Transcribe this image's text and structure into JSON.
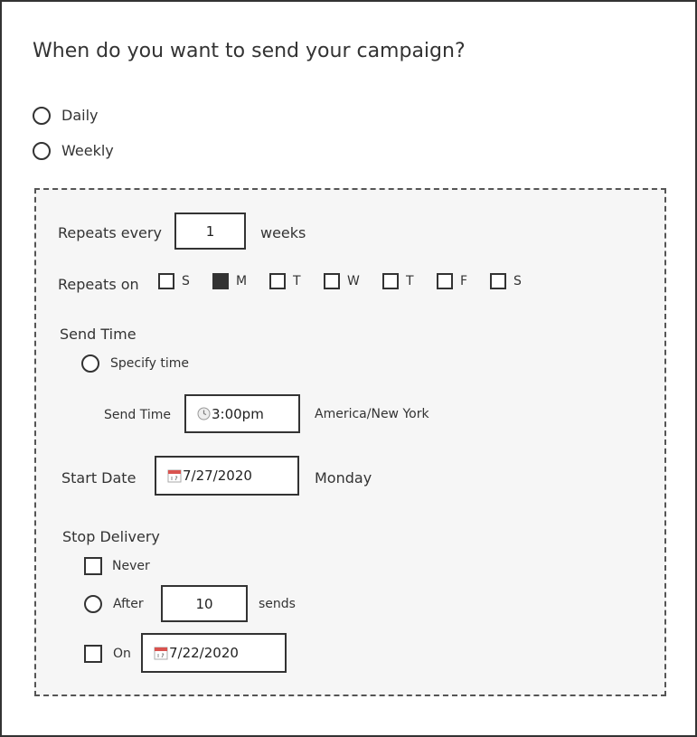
{
  "page": {
    "title": "When do you want to send your campaign?"
  },
  "frequency": {
    "options": [
      {
        "label": "Daily",
        "selected": false
      },
      {
        "label": "Weekly",
        "selected": false
      }
    ]
  },
  "settings": {
    "repeats_every": {
      "label": "Repeats every",
      "value": "1",
      "unit": "weeks"
    },
    "repeats_on": {
      "label": "Repeats on",
      "days": [
        {
          "label": "S",
          "checked": false
        },
        {
          "label": "M",
          "checked": true
        },
        {
          "label": "T",
          "checked": false
        },
        {
          "label": "W",
          "checked": false
        },
        {
          "label": "T",
          "checked": false
        },
        {
          "label": "F",
          "checked": false
        },
        {
          "label": "S",
          "checked": false
        }
      ]
    },
    "send_time": {
      "section_label": "Send Time",
      "specify_label": "Specify time",
      "field_label": "Send Time",
      "value": "3:00pm",
      "timezone": "America/New York",
      "icon": "clock-icon"
    },
    "start_date": {
      "label": "Start Date",
      "value": "7/27/2020",
      "weekday": "Monday",
      "icon": "calendar-icon"
    },
    "stop_delivery": {
      "label": "Stop Delivery",
      "never_label": "Never",
      "after_label": "After",
      "after_value": "10",
      "after_unit": "sends",
      "on_label": "On",
      "on_value": "7/22/2020"
    }
  },
  "colors": {
    "ink": "#333333",
    "panel_bg": "#f6f6f6",
    "calendar_red": "#d9534f"
  }
}
